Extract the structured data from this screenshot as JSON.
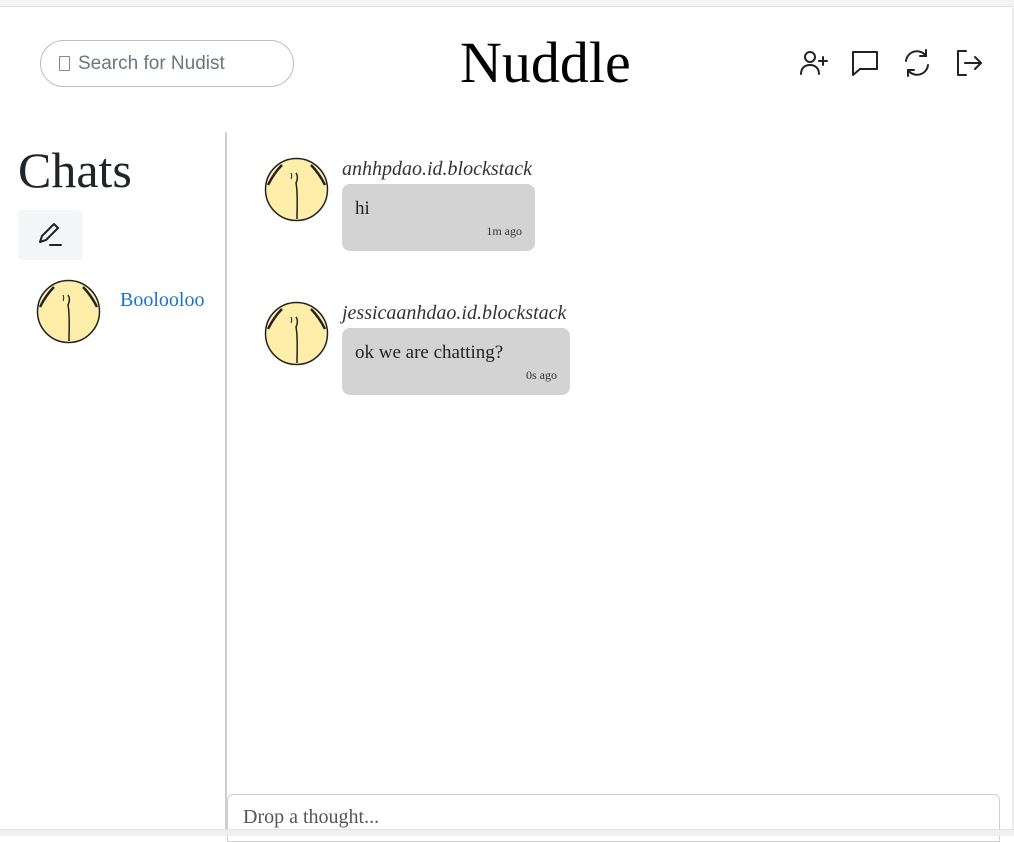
{
  "header": {
    "search_placeholder": "Search for Nudist",
    "logo": "Nuddle",
    "icons": [
      "add-user-icon",
      "message-icon",
      "refresh-icon",
      "logout-icon"
    ]
  },
  "sidebar": {
    "title": "Chats",
    "compose_icon": "pen-icon",
    "contacts": [
      {
        "name": "Boolooloo",
        "avatar": "avatar-icon"
      }
    ]
  },
  "messages": [
    {
      "sender": "anhhpdao.id.blockstack",
      "text": "hi",
      "time": "1m ago"
    },
    {
      "sender": "jessicaanhdao.id.blockstack",
      "text": "ok we are chatting?",
      "time": "0s ago"
    }
  ],
  "composer": {
    "placeholder": "Drop a thought..."
  },
  "colors": {
    "link": "#1a73c9",
    "bubble": "#d3d3d3",
    "avatar": "#ffeeaa"
  }
}
